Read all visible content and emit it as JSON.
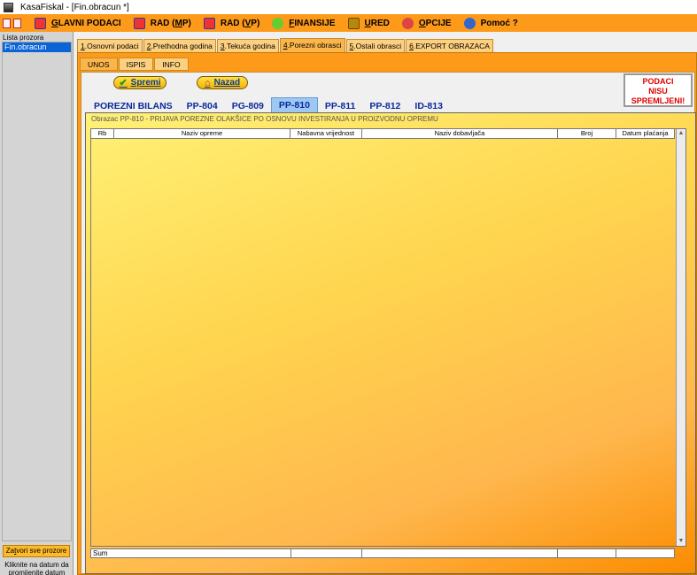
{
  "window": {
    "title": "KasaFiskal   - [Fin.obracun *]"
  },
  "menubar": {
    "items": [
      {
        "prefix": "",
        "underline": "G",
        "rest": "LAVNI PODACI",
        "icon": "hand-icon"
      },
      {
        "prefix": "RAD (",
        "underline": "M",
        "rest": "P)",
        "icon": "hand-icon"
      },
      {
        "prefix": "RAD (",
        "underline": "V",
        "rest": "P)",
        "icon": "hand-icon"
      },
      {
        "prefix": "",
        "underline": "F",
        "rest": "INANSIJE",
        "icon": "dollar-icon"
      },
      {
        "prefix": "",
        "underline": "U",
        "rest": "RED",
        "icon": "box-icon"
      },
      {
        "prefix": "",
        "underline": "O",
        "rest": "PCIJE",
        "icon": "gear-icon"
      },
      {
        "prefix": "",
        "underline": "",
        "rest": "Pomoć ?",
        "icon": "help-icon"
      }
    ]
  },
  "sidebar": {
    "title": "Lista prozora",
    "items": [
      "Fin.obracun"
    ],
    "close_all_prefix": "Za",
    "close_all_underline": "t",
    "close_all_rest": "vori sve prozore",
    "hint": "Kliknite na datum da promijenite datum"
  },
  "main_tabs": [
    {
      "num": "1",
      "label": ".Osnovni podaci",
      "active": false
    },
    {
      "num": "2",
      "label": ".Prethodna godina",
      "active": false
    },
    {
      "num": "3",
      "label": ".Tekuća godina",
      "active": false
    },
    {
      "num": "4",
      "label": ".Porezni obrasci",
      "active": true
    },
    {
      "num": "5",
      "label": ".Ostali obrasci",
      "active": false
    },
    {
      "num": "6",
      "label": ".EXPORT OBRAZACA",
      "active": false
    }
  ],
  "sub_tabs": [
    {
      "label": "UNOS",
      "active": true
    },
    {
      "label": "ISPIS",
      "active": false
    },
    {
      "label": "INFO",
      "active": false
    }
  ],
  "buttons": {
    "save": "Spremi",
    "back": "Nazad"
  },
  "status_lines": [
    "PODACI",
    "NISU",
    "SPREMLJENI!"
  ],
  "form_tabs": [
    {
      "label": "POREZNI BILANS",
      "active": false
    },
    {
      "label": "PP-804",
      "active": false
    },
    {
      "label": "PG-809",
      "active": false
    },
    {
      "label": "PP-810",
      "active": true
    },
    {
      "label": "PP-811",
      "active": false
    },
    {
      "label": "PP-812",
      "active": false
    },
    {
      "label": "ID-813",
      "active": false
    }
  ],
  "form_title": "Obrazac PP-810 - PRIJAVA POREZNE OLAKŠICE PO OSNOVU INVESTIRANJA U PROIZVODNU OPREMU",
  "grid": {
    "columns": [
      "Rb",
      "Naziv opreme",
      "Nabavna vrijednost",
      "Naziv dobavljača",
      "Broj",
      "Datum plaćanja"
    ],
    "rows": [],
    "sum_label": "Sum"
  },
  "colors": {
    "menubar": "#fd9a1a",
    "status_text": "#dd0000",
    "link_blue": "#0a2a9a"
  }
}
